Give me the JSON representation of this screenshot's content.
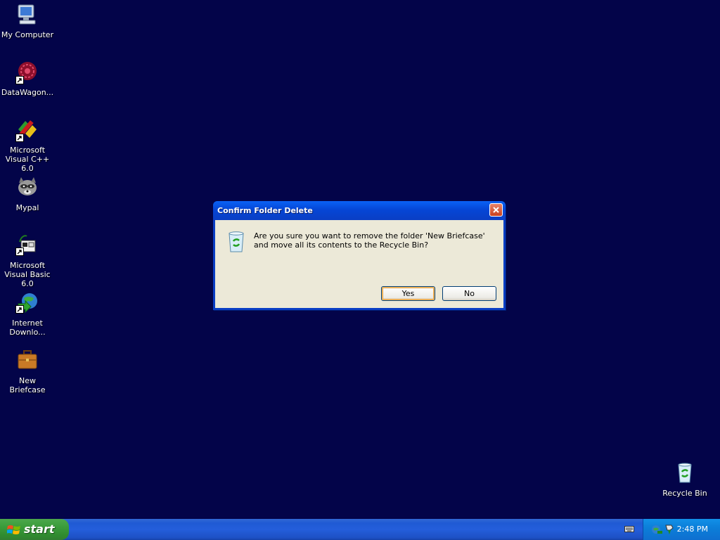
{
  "desktop": {
    "icons": [
      {
        "label": "My Computer"
      },
      {
        "label": "DataWagon..."
      },
      {
        "label": "Microsoft Visual C++ 6.0"
      },
      {
        "label": "Mypal"
      },
      {
        "label": "Microsoft Visual Basic 6.0"
      },
      {
        "label": "Internet Downlo..."
      },
      {
        "label": "New Briefcase"
      },
      {
        "label": "Recycle Bin"
      }
    ]
  },
  "dialog": {
    "title": "Confirm Folder Delete",
    "message": "Are you sure you want to remove the folder 'New Briefcase' and move all its contents to the Recycle Bin?",
    "yes_label": "Yes",
    "no_label": "No"
  },
  "taskbar": {
    "start_label": "start",
    "clock": "2:48 PM"
  },
  "colors": {
    "desktop_bg": "#030449",
    "taskbar": "#245edb",
    "start_button": "#3a9b3a",
    "dialog_title": "#0a3ec4"
  }
}
